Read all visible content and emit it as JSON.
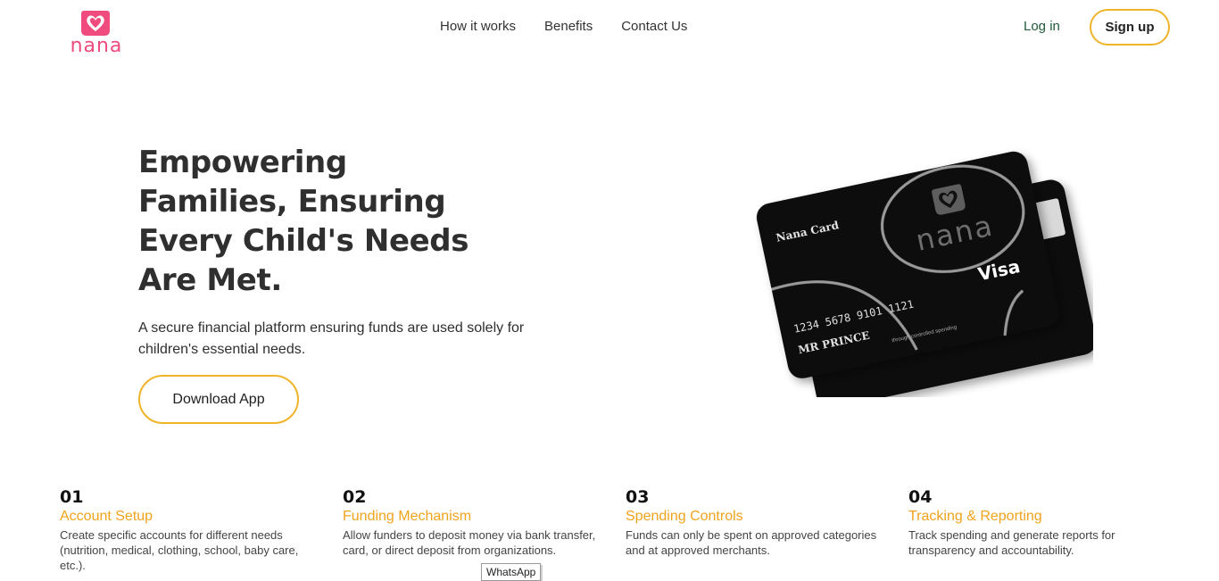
{
  "brand": {
    "name": "nana",
    "accent": "#ef4b7e",
    "button_border": "#f0b429",
    "feature_title_color": "#f0a31c"
  },
  "nav": {
    "items": [
      {
        "label": "How it works"
      },
      {
        "label": "Benefits"
      },
      {
        "label": "Contact Us"
      }
    ],
    "login_label": "Log in",
    "signup_label": "Sign up"
  },
  "hero": {
    "title": "Empowering Families, Ensuring Every Child's Needs Are Met.",
    "subtitle": "A secure financial platform ensuring funds are used solely for children's essential needs.",
    "download_label": "Download App"
  },
  "card": {
    "label": "Nana Card",
    "number": "1234 5678 9101 1121",
    "holder": "MR PRINCE",
    "network": "Visa",
    "logo_text": "nana",
    "tagline": "through controlled spending"
  },
  "features": [
    {
      "num": "01",
      "title": "Account Setup",
      "desc": "Create specific accounts for different needs (nutrition, medical, clothing, school, baby care, etc.)."
    },
    {
      "num": "02",
      "title": "Funding Mechanism",
      "desc": "Allow funders to deposit money via bank transfer, card, or direct deposit from organizations."
    },
    {
      "num": "03",
      "title": "Spending Controls",
      "desc": "Funds can only be spent on approved categories and at approved merchants."
    },
    {
      "num": "04",
      "title": "Tracking & Reporting",
      "desc": "Track spending and generate reports for transparency and accountability."
    }
  ],
  "tooltip": {
    "label": "WhatsApp"
  }
}
